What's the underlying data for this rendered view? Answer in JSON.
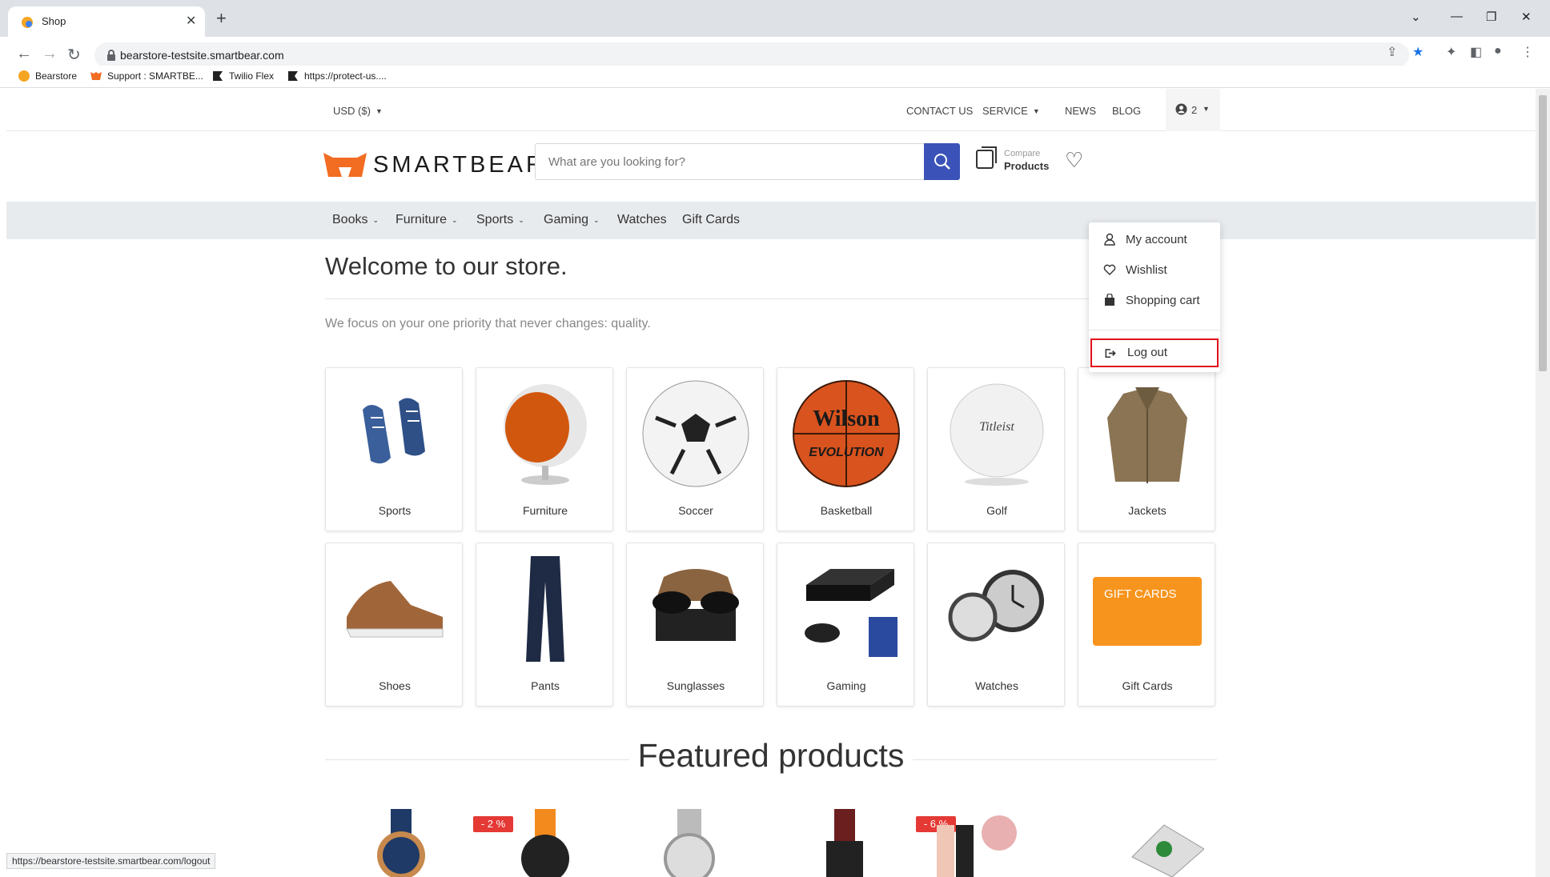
{
  "browser": {
    "tab_title": "Shop",
    "url": "bearstore-testsite.smartbear.com",
    "bookmarks": [
      "Bearstore",
      "Support : SMARTBE...",
      "Twilio Flex",
      "https://protect-us...."
    ],
    "status_url": "https://bearstore-testsite.smartbear.com/logout"
  },
  "topbar": {
    "currency": "USD  ($)",
    "contact": "CONTACT US",
    "service": "SERVICE",
    "news": "NEWS",
    "blog": "BLOG",
    "user_count": "2"
  },
  "header": {
    "logo_text": "SMARTBEAR",
    "logo_mark": ".",
    "search_placeholder": "What are you looking for?",
    "compare_small": "Compare",
    "compare_big": "Products"
  },
  "categories_nav": [
    "Books",
    "Furniture",
    "Sports",
    "Gaming",
    "Watches",
    "Gift Cards"
  ],
  "main": {
    "welcome": "Welcome to our store.",
    "tagline": "We focus on your one priority that never changes: quality.",
    "featured": "Featured products"
  },
  "tiles": [
    "Sports",
    "Furniture",
    "Soccer",
    "Basketball",
    "Golf",
    "Jackets",
    "Shoes",
    "Pants",
    "Sunglasses",
    "Gaming",
    "Watches",
    "Gift Cards"
  ],
  "tile_text": {
    "wilson": "Wilson",
    "evolution": "EVOLUTION",
    "titleist": "Titleist",
    "giftcards": "GIFT CARDS"
  },
  "badges": [
    "- 2 %",
    "- 6 %"
  ],
  "user_menu": {
    "my_account": "My account",
    "wishlist": "Wishlist",
    "cart": "Shopping cart",
    "logout": "Log out"
  },
  "colors": {
    "brand_orange": "#f26c22",
    "search_blue": "#3b53b8",
    "highlight_red": "#e0101b"
  }
}
